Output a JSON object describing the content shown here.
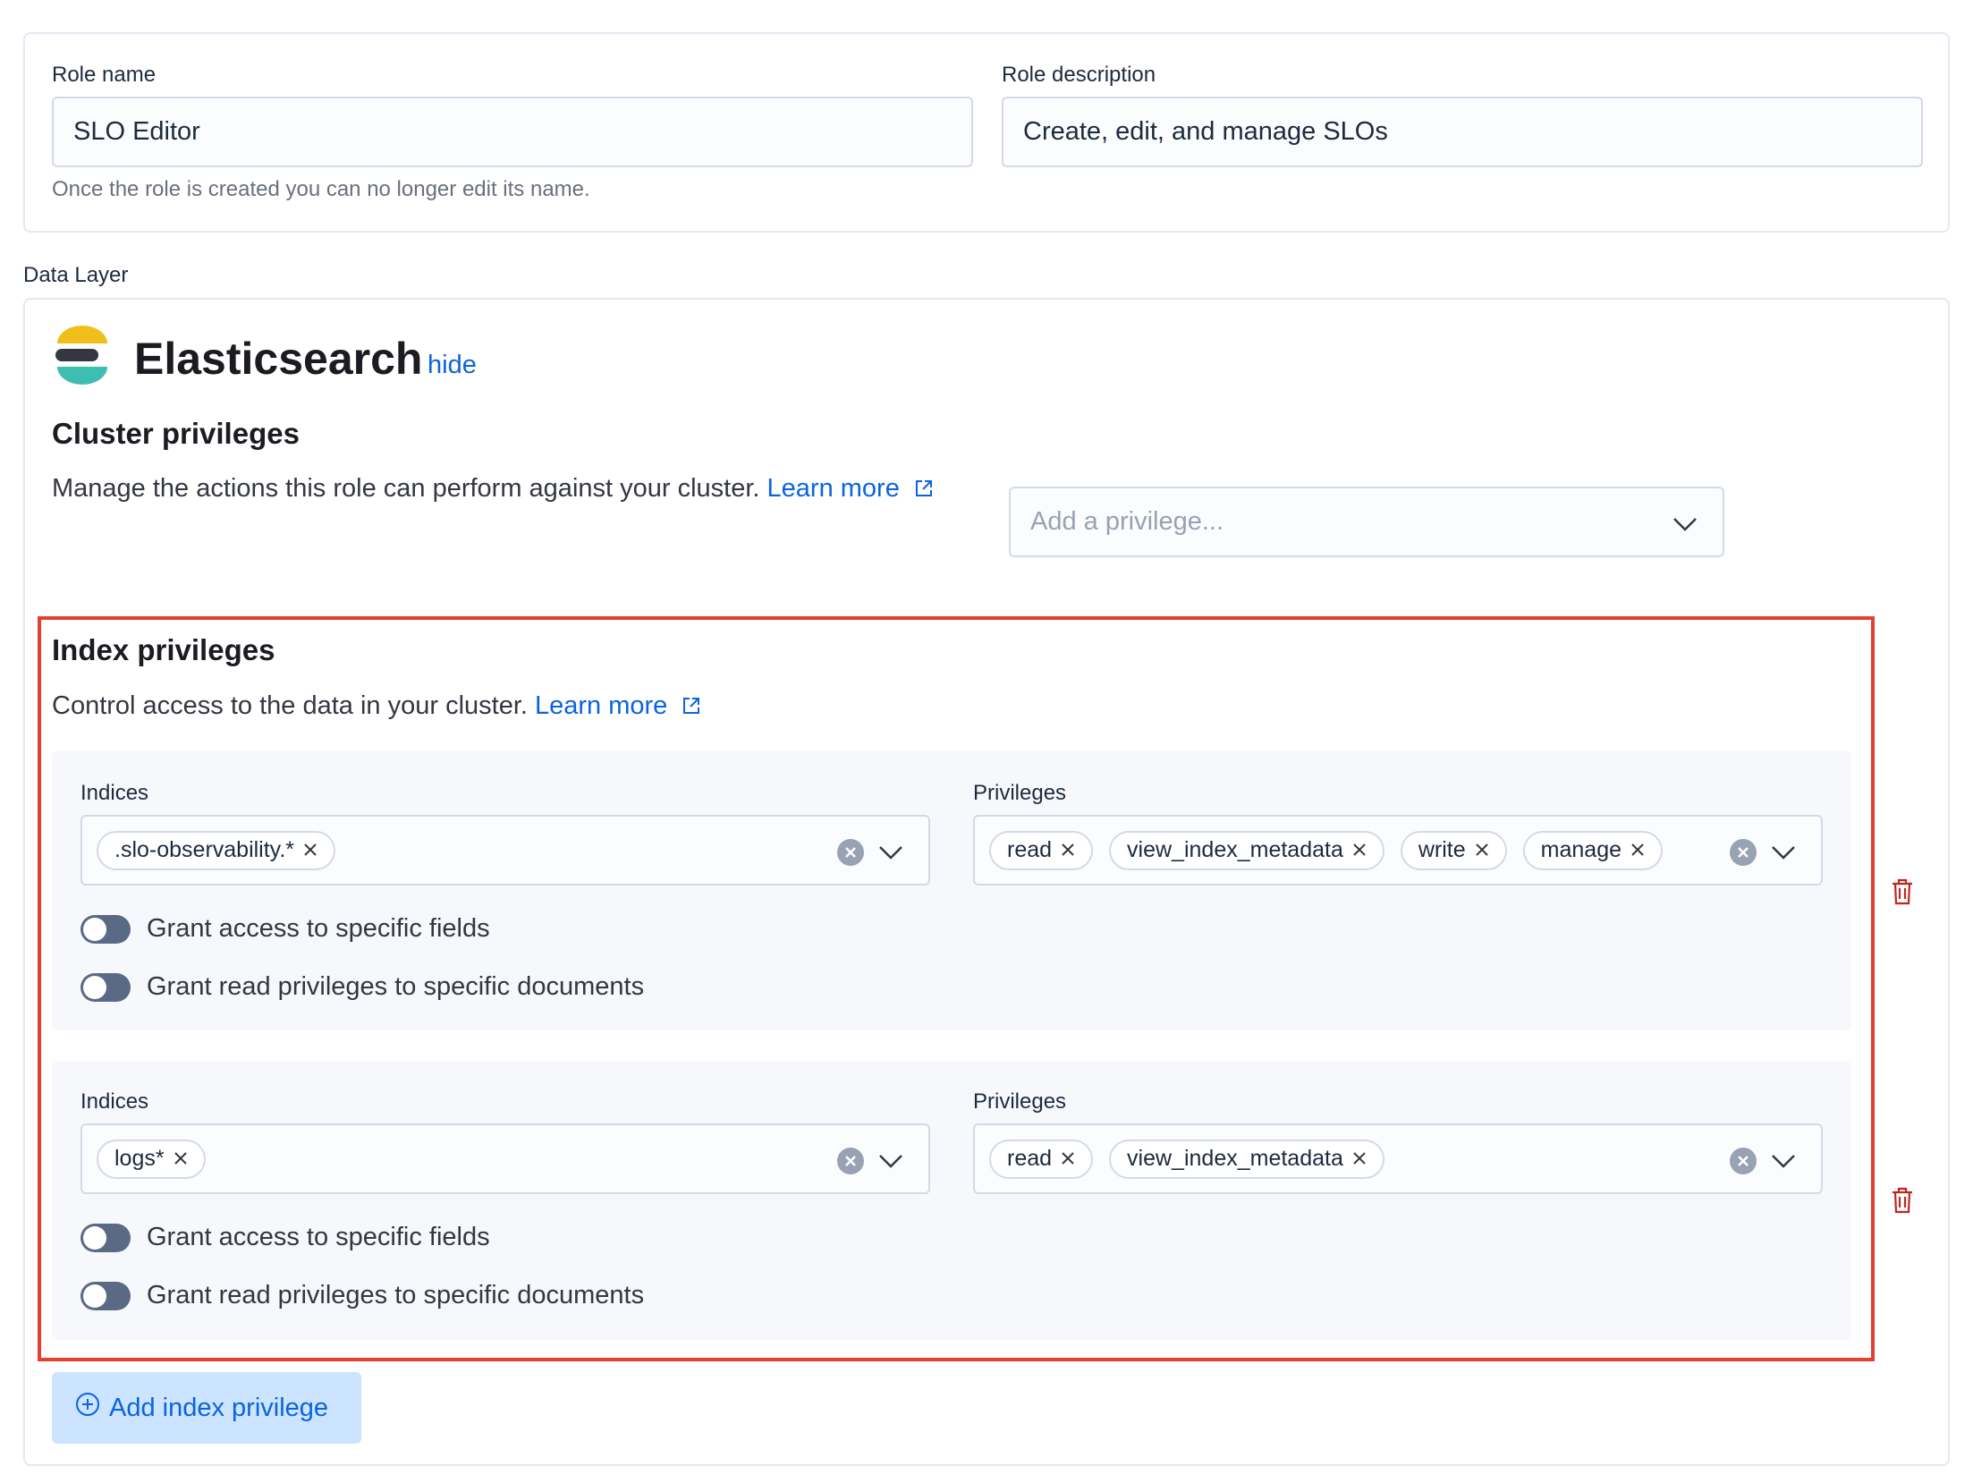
{
  "role": {
    "name_label": "Role name",
    "name_value": "SLO Editor",
    "name_help": "Once the role is created you can no longer edit its name.",
    "description_label": "Role description",
    "description_value": "Create, edit, and manage SLOs"
  },
  "data_layer_label": "Data Layer",
  "elasticsearch": {
    "title": "Elasticsearch",
    "hide_link": "hide"
  },
  "cluster": {
    "title": "Cluster privileges",
    "description": "Manage the actions this role can perform against your cluster.",
    "learn_more": "Learn more",
    "placeholder": "Add a privilege..."
  },
  "index": {
    "title": "Index privileges",
    "description": "Control access to the data in your cluster.",
    "learn_more": "Learn more",
    "entries": [
      {
        "indices_label": "Indices",
        "indices": [
          ".slo-observability.*"
        ],
        "privileges_label": "Privileges",
        "privileges": [
          "read",
          "view_index_metadata",
          "write",
          "manage"
        ],
        "toggle_fields": "Grant access to specific fields",
        "toggle_docs": "Grant read privileges to specific documents"
      },
      {
        "indices_label": "Indices",
        "indices": [
          "logs*"
        ],
        "privileges_label": "Privileges",
        "privileges": [
          "read",
          "view_index_metadata"
        ],
        "toggle_fields": "Grant access to specific fields",
        "toggle_docs": "Grant read privileges to specific documents"
      }
    ],
    "add_button": "Add index privilege"
  },
  "colors": {
    "accent": "#0b64dd",
    "highlight_box": "#e4402f",
    "delete_icon": "#bd271e"
  }
}
